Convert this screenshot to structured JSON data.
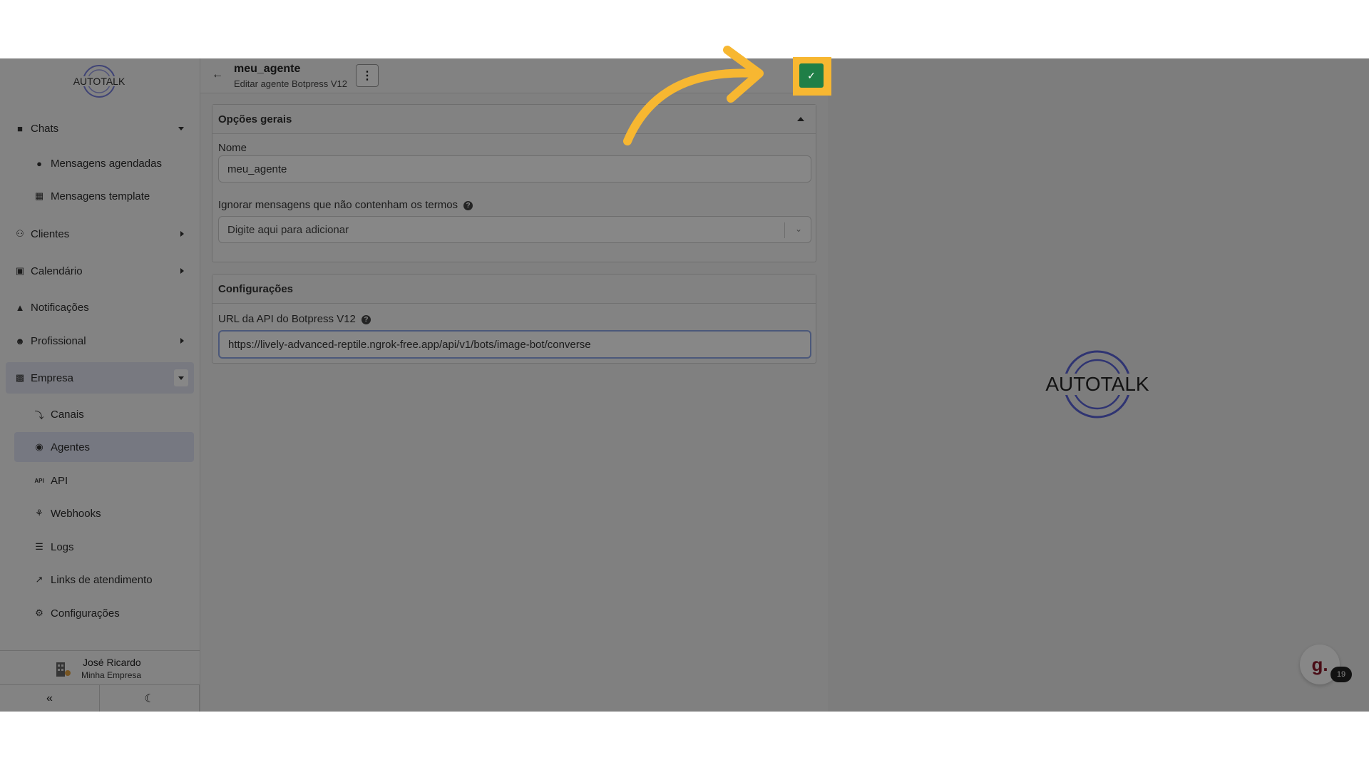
{
  "sidebar": {
    "logo_text": "AUTOTALK",
    "items": [
      {
        "label": "Chats",
        "icon": "chat-bubble-icon"
      },
      {
        "label": "Mensagens agendadas",
        "icon": "clock-icon"
      },
      {
        "label": "Mensagens template",
        "icon": "template-icon"
      },
      {
        "label": "Clientes",
        "icon": "users-icon"
      },
      {
        "label": "Calendário",
        "icon": "calendar-icon"
      },
      {
        "label": "Notificações",
        "icon": "bell-icon"
      },
      {
        "label": "Profissional",
        "icon": "user-cog-icon"
      },
      {
        "label": "Empresa",
        "icon": "building-icon"
      },
      {
        "label": "Canais",
        "icon": "plug-icon"
      },
      {
        "label": "Agentes",
        "icon": "robot-icon"
      },
      {
        "label": "API",
        "icon": "api-icon"
      },
      {
        "label": "Webhooks",
        "icon": "webhook-icon"
      },
      {
        "label": "Logs",
        "icon": "list-icon"
      },
      {
        "label": "Links de atendimento",
        "icon": "external-link-icon"
      },
      {
        "label": "Configurações",
        "icon": "gear-icon"
      }
    ],
    "user": {
      "name": "José Ricardo",
      "company": "Minha Empresa"
    },
    "collapse_glyph": "«",
    "theme_glyph": "☾"
  },
  "header": {
    "title": "meu_agente",
    "subtitle": "Editar agente Botpress V12",
    "back_glyph": "←",
    "menu_glyph": "⋮",
    "save_glyph": "✓"
  },
  "general": {
    "title": "Opções gerais",
    "name_label": "Nome",
    "name_value": "meu_agente",
    "ignore_label": "Ignorar mensagens que não contenham os termos",
    "ignore_placeholder": "Digite aqui para adicionar"
  },
  "config": {
    "title": "Configurações",
    "url_label": "URL da API do Botpress V12",
    "url_value": "https://lively-advanced-reptile.ngrok-free.app/api/v1/bots/image-bot/converse"
  },
  "right": {
    "logo_text": "AUTOTALK"
  },
  "chat_widget": {
    "glyph": "g.",
    "count": "19"
  },
  "colors": {
    "highlight": "#f7b731",
    "save_green": "#1f8a4c",
    "active_nav": "#dfe2f4",
    "logo_ring": "#5a63d8"
  }
}
